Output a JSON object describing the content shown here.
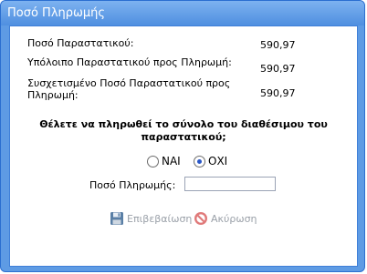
{
  "dialog": {
    "title": "Ποσό Πληρωμής"
  },
  "summary": {
    "document_amount_label": "Ποσό Παραστατικού:",
    "document_amount_value": "590,97",
    "remaining_label": "Υπόλοιπο Παραστατικού προς Πληρωμή:",
    "remaining_value": "590,97",
    "related_label_line1": "Συσχετισμένο Ποσό Παραστατικού προς",
    "related_label_line2": "Πληρωμή:",
    "related_value": "590,97"
  },
  "question": {
    "line1": "Θέλετε να πληρωθεί το σύνολο του διαθέσιμου του",
    "line2": "παραστατικού;"
  },
  "options": {
    "yes_label": "ΝΑΙ",
    "no_label": "ΟΧΙ",
    "selected": "ΟΧΙ"
  },
  "payment": {
    "amount_label": "Ποσό Πληρωμής:",
    "amount_value": ""
  },
  "buttons": {
    "confirm_label": "Επιβεβαίωση",
    "cancel_label": "Ακύρωση",
    "confirm_enabled": false,
    "cancel_enabled": false
  },
  "icons": {
    "confirm": "floppy-disk-icon",
    "cancel": "no-entry-icon"
  },
  "colors": {
    "title_bar": "#5e9be4",
    "disabled_text": "#9aa0a8"
  }
}
